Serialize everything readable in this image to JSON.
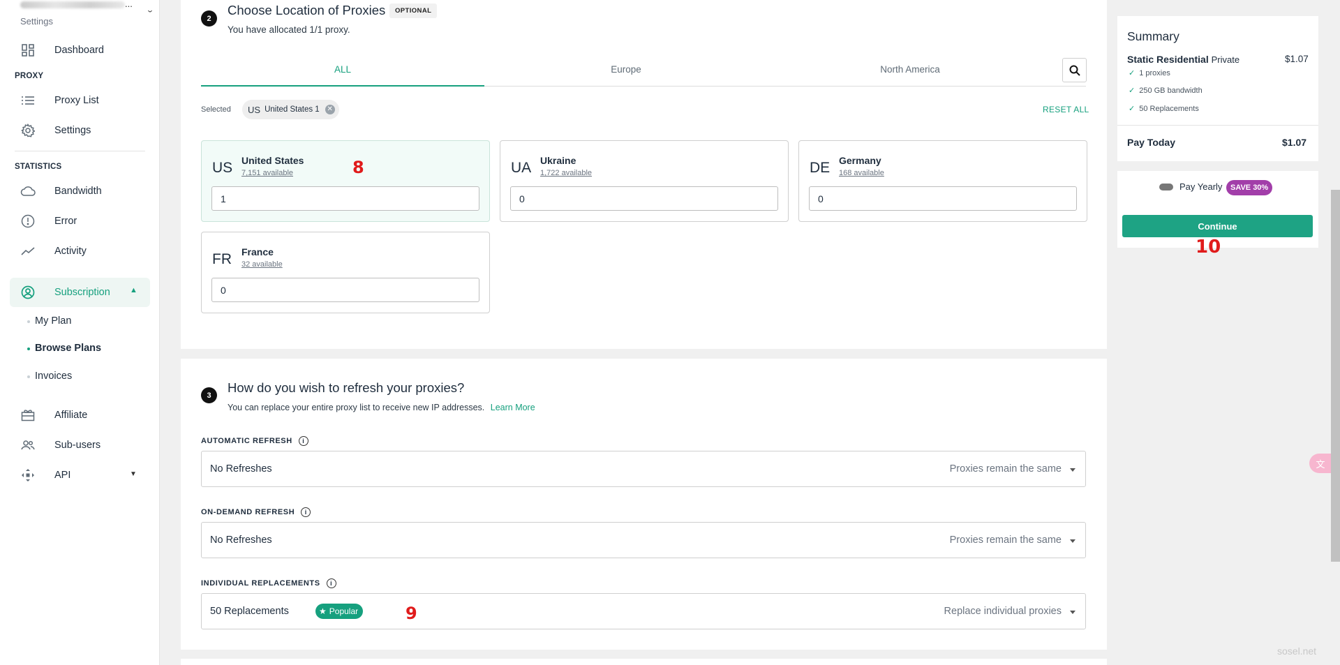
{
  "sidebar": {
    "account_sub": "Settings",
    "items": {
      "dashboard": "Dashboard",
      "proxy_heading": "PROXY",
      "proxy_list": "Proxy List",
      "settings": "Settings",
      "statistics_heading": "STATISTICS",
      "bandwidth": "Bandwidth",
      "error": "Error",
      "activity": "Activity",
      "subscription": "Subscription",
      "my_plan": "My Plan",
      "browse_plans": "Browse Plans",
      "invoices": "Invoices",
      "affiliate": "Affiliate",
      "sub_users": "Sub-users",
      "api": "API"
    }
  },
  "location_section": {
    "step": "2",
    "title": "Choose Location of Proxies",
    "optional_badge": "OPTIONAL",
    "subtitle": "You have allocated 1/1 proxy.",
    "tabs": [
      "ALL",
      "Europe",
      "North America"
    ],
    "active_tab": "ALL",
    "selected_label": "Selected",
    "selected_chip": {
      "code": "US",
      "label": "United States 1"
    },
    "reset_all": "RESET ALL",
    "locations": [
      {
        "code": "US",
        "name": "United States",
        "available": "7,151 available",
        "qty": "1",
        "selected": true
      },
      {
        "code": "UA",
        "name": "Ukraine",
        "available": "1,722 available",
        "qty": "0",
        "selected": false
      },
      {
        "code": "DE",
        "name": "Germany",
        "available": "168 available",
        "qty": "0",
        "selected": false
      },
      {
        "code": "FR",
        "name": "France",
        "available": "32 available",
        "qty": "0",
        "selected": false
      }
    ]
  },
  "refresh_section": {
    "step": "3",
    "title": "How do you wish to refresh your proxies?",
    "subtitle": "You can replace your entire proxy list to receive new IP addresses.",
    "learn_more": "Learn More",
    "automatic": {
      "label": "AUTOMATIC REFRESH",
      "value": "No Refreshes",
      "hint": "Proxies remain the same"
    },
    "on_demand": {
      "label": "ON-DEMAND REFRESH",
      "value": "No Refreshes",
      "hint": "Proxies remain the same"
    },
    "individual": {
      "label": "INDIVIDUAL REPLACEMENTS",
      "value": "50 Replacements",
      "badge": "Popular",
      "hint": "Replace individual proxies"
    }
  },
  "summary": {
    "title": "Summary",
    "plan": "Static Residential",
    "plan_type": "Private",
    "price": "$1.07",
    "features": [
      "1 proxies",
      "250 GB bandwidth",
      "50 Replacements"
    ],
    "pay_today_label": "Pay Today",
    "pay_today_amount": "$1.07",
    "pay_yearly": "Pay Yearly",
    "save_badge": "SAVE 30%",
    "continue": "Continue"
  },
  "annotations": [
    "8",
    "9",
    "10"
  ],
  "watermark": "sosel.net",
  "colors": {
    "accent": "#16a07e",
    "save_badge": "#a23ea9",
    "annotation": "#e01b1b"
  }
}
